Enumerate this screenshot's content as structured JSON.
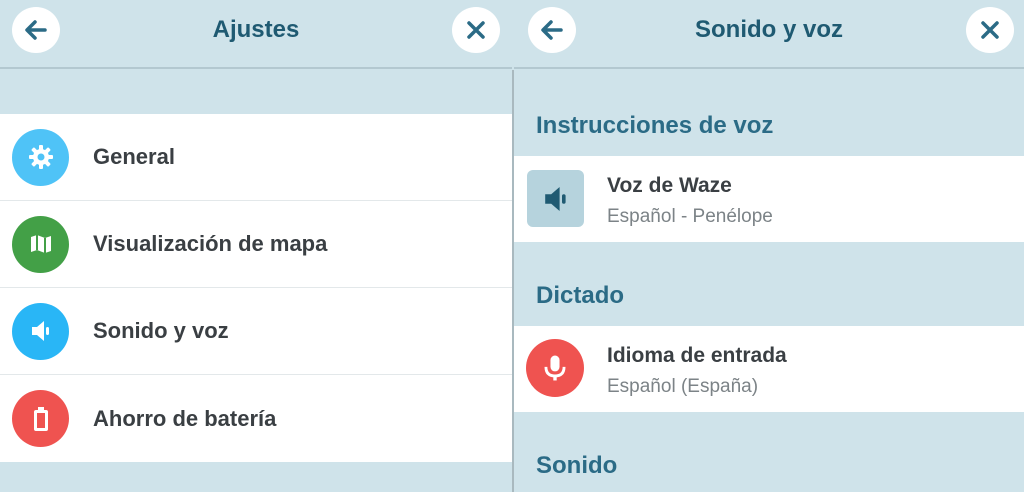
{
  "left_panel": {
    "title": "Ajustes",
    "back_icon": "arrow-left-icon",
    "close_icon": "close-icon",
    "items": [
      {
        "label": "General",
        "icon": "gear-icon",
        "color": "#4fc3f7"
      },
      {
        "label": "Visualización de mapa",
        "icon": "map-icon",
        "color": "#43a047"
      },
      {
        "label": "Sonido y voz",
        "icon": "speaker-icon",
        "color": "#29b6f6"
      },
      {
        "label": "Ahorro de batería",
        "icon": "battery-icon",
        "color": "#ef5350"
      }
    ]
  },
  "right_panel": {
    "title": "Sonido y voz",
    "back_icon": "arrow-left-icon",
    "close_icon": "close-icon",
    "sections": [
      {
        "heading": "Instrucciones de voz",
        "item": {
          "title": "Voz de Waze",
          "subtitle": "Español - Penélope",
          "icon": "speaker-icon"
        }
      },
      {
        "heading": "Dictado",
        "item": {
          "title": "Idioma de entrada",
          "subtitle": "Español (España)",
          "icon": "microphone-icon"
        }
      },
      {
        "heading": "Sonido"
      }
    ]
  },
  "colors": {
    "background": "#cfe3ea",
    "title_text": "#1f5a72",
    "section_text": "#2b6b86"
  }
}
